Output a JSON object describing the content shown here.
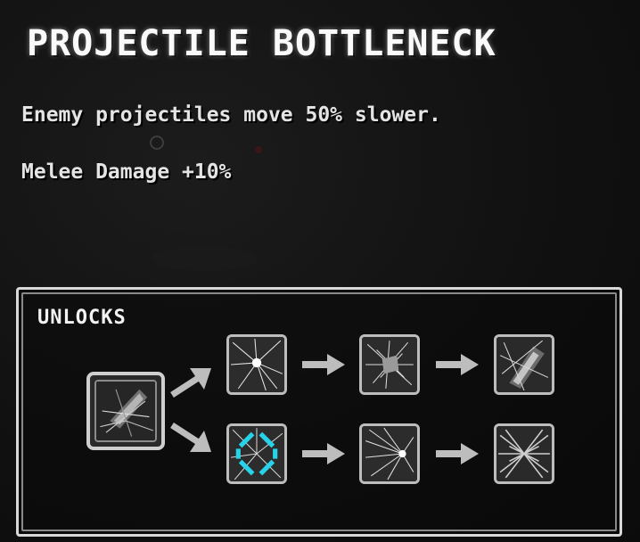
{
  "card": {
    "title": "PROJECTILE BOTTLENECK",
    "description": "Enemy projectiles move 50% slower.",
    "bonus": "Melee Damage +10%"
  },
  "unlocks": {
    "label": "UNLOCKS",
    "root": {
      "icon": "shattered-glass-icon"
    },
    "rows": [
      {
        "nodes": [
          {
            "icon": "shatter-burst-icon"
          },
          {
            "icon": "shatter-burst-icon"
          },
          {
            "icon": "shatter-shard-icon"
          }
        ]
      },
      {
        "nodes": [
          {
            "icon": "shatter-burst-icon",
            "selected": true
          },
          {
            "icon": "shatter-burst-icon"
          },
          {
            "icon": "shatter-shard-icon"
          }
        ]
      }
    ]
  },
  "colors": {
    "highlight": "#27d3e8",
    "border": "#d8d8d8"
  }
}
